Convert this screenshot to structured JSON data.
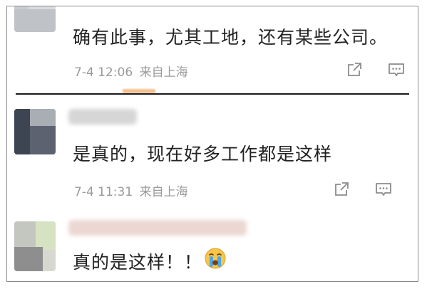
{
  "comments": [
    {
      "text": "确有此事，尤其工地，还有某些公司。",
      "date": "7-4 12:06",
      "location": "来自上海"
    },
    {
      "text": "是真的，现在好多工作都是这样",
      "date": "7-4 11:31",
      "location": "来自上海"
    },
    {
      "text": "真的是这样！！",
      "emoji": "crying-face-emoji"
    }
  ],
  "icons": {
    "share": "share-icon",
    "reply": "comment-icon"
  },
  "colors": {
    "text": "#222222",
    "meta": "#9a9a9a",
    "icon": "#8c8c8c",
    "divider": "#1a1a1a"
  }
}
